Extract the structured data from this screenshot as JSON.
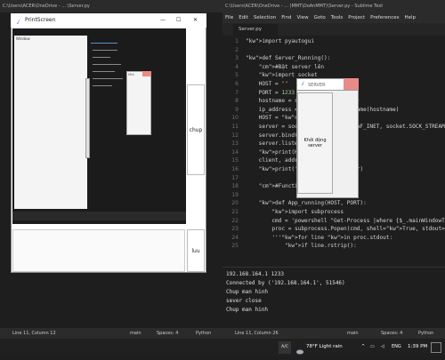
{
  "left_window": {
    "title": "C:\\Users\\ACER\\OneDrive - ... \\Server.py",
    "statusbar": {
      "position": "Line 11, Column 12",
      "branch": "main",
      "spaces": "Spaces: 4",
      "language": "Python"
    }
  },
  "printscreen_window": {
    "title": "PrintScreen",
    "chup_label": "chup",
    "luu_label": "luu",
    "inner_caption": "Window",
    "inner_small": "Mini"
  },
  "editor": {
    "title": "C:\\Users\\ACER\\OneDrive - ... (MMT\\DoAnMMT)\\Server.py - Sublime Text",
    "menu": [
      "File",
      "Edit",
      "Selection",
      "Find",
      "View",
      "Goto",
      "Tools",
      "Project",
      "Preferences",
      "Help"
    ],
    "tab": "Server.py",
    "code_lines": [
      {
        "n": "1",
        "t": "import pyautogui"
      },
      {
        "n": "2",
        "t": ""
      },
      {
        "n": "3",
        "t": "def Server_Running():"
      },
      {
        "n": "4",
        "t": "    #Bật server lên"
      },
      {
        "n": "5",
        "t": "    import socket"
      },
      {
        "n": "6",
        "t": "    HOST = \"\""
      },
      {
        "n": "7",
        "t": "    PORT = 1233"
      },
      {
        "n": "8",
        "t": "    hostname = socket.gethostname()"
      },
      {
        "n": "9",
        "t": "    ip_address = socket.gethostbyname(hostname)"
      },
      {
        "n": "10",
        "t": "    HOST = str(ip_address)"
      },
      {
        "n": "11",
        "t": "    server = socket.socket(socket.AF_INET, socket.SOCK_STREAM)"
      },
      {
        "n": "12",
        "t": "    server.bind((HOST, PORT))"
      },
      {
        "n": "13",
        "t": "    server.listen()"
      },
      {
        "n": "14",
        "t": "    print(HOST, PORT)"
      },
      {
        "n": "15",
        "t": "    client, addr = server.accept()"
      },
      {
        "n": "16",
        "t": "    print(\"Connected by\", addr)"
      },
      {
        "n": "17",
        "t": ""
      },
      {
        "n": "18",
        "t": "    #Function của Server"
      },
      {
        "n": "19",
        "t": ""
      },
      {
        "n": "20",
        "t": "    def App_running(HOST, PORT):"
      },
      {
        "n": "21",
        "t": "        import subprocess"
      },
      {
        "n": "22",
        "t": "        cmd = 'powershell \"Get-Process |where {$_.mainWindowTitle}'"
      },
      {
        "n": "23",
        "t": "        proc = subprocess.Popen(cmd, shell=True, stdout=subprocess.PIPE)"
      },
      {
        "n": "24",
        "t": "        '''for line in proc.stdout:"
      },
      {
        "n": "25",
        "t": "            if line.rstrip():"
      }
    ],
    "console": [
      "192.168.164.1 1233",
      "Connected by ('192.168.164.1', 51546)",
      "Chup man hinh",
      "sever close",
      "Chup man hinh"
    ],
    "statusbar": {
      "position": "Line 11, Column 26",
      "branch": "main",
      "spaces": "Spaces: 4",
      "language": "Python"
    }
  },
  "server_window": {
    "title": "SERVER",
    "button": "Khởi động server"
  },
  "taskbar": {
    "weather": "78°F  Light rain",
    "lang": "ENG",
    "time": "1:39 PM",
    "ac_label": "A/C"
  }
}
